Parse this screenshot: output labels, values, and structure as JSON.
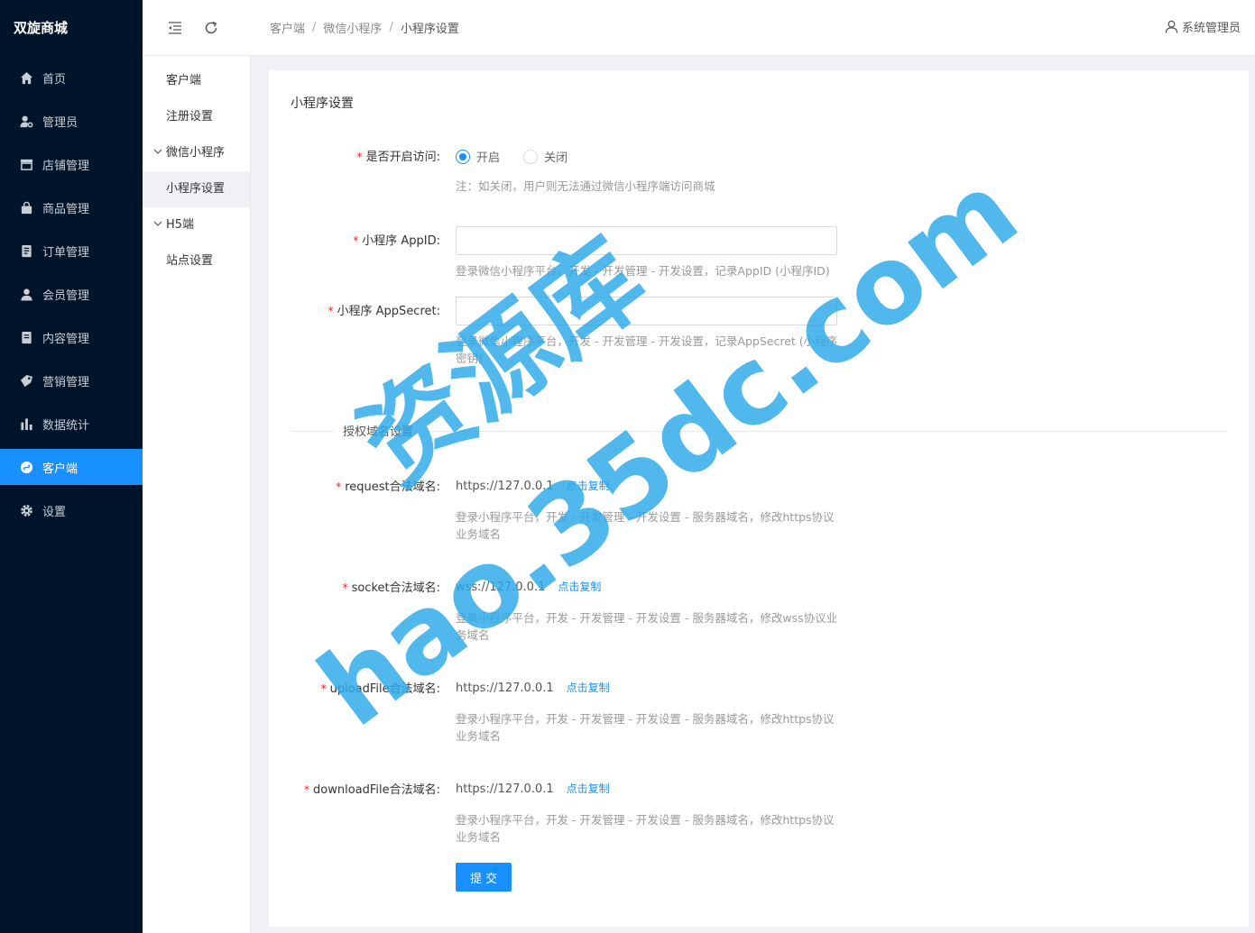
{
  "brand": "双旋商城",
  "nav": [
    {
      "label": "首页",
      "icon": "home-icon"
    },
    {
      "label": "管理员",
      "icon": "admin-user-icon"
    },
    {
      "label": "店铺管理",
      "icon": "shop-icon"
    },
    {
      "label": "商品管理",
      "icon": "bag-icon"
    },
    {
      "label": "订单管理",
      "icon": "order-icon"
    },
    {
      "label": "会员管理",
      "icon": "member-icon"
    },
    {
      "label": "内容管理",
      "icon": "content-icon"
    },
    {
      "label": "营销管理",
      "icon": "marketing-icon"
    },
    {
      "label": "数据统计",
      "icon": "chart-icon"
    },
    {
      "label": "客户端",
      "icon": "client-icon",
      "active": true
    },
    {
      "label": "设置",
      "icon": "gear-icon"
    }
  ],
  "submenu": {
    "item_client": "客户端",
    "item_register": "注册设置",
    "group_wechat": "微信小程序",
    "item_mini_settings": "小程序设置",
    "group_h5": "H5端",
    "item_site": "站点设置"
  },
  "header": {
    "breadcrumb": [
      "客户端",
      "微信小程序",
      "小程序设置"
    ],
    "separator": "/",
    "user": "系统管理员"
  },
  "form": {
    "title": "小程序设置",
    "access_label": "是否开启访问:",
    "radio_on": "开启",
    "radio_off": "关闭",
    "access_selected": "开启",
    "access_hint": "注：如关闭，用户则无法通过微信小程序端访问商城",
    "appid_label": "小程序 AppID:",
    "appid_value": "",
    "appid_hint": "登录微信小程序平台，开发 - 开发管理 - 开发设置，记录AppID (小程序ID)",
    "secret_label": "小程序 AppSecret:",
    "secret_value": "",
    "secret_hint": "登录微信小程序平台，开发 - 开发管理 - 开发设置，记录AppSecret (小程序密钥)",
    "domain_section": "授权域名设置",
    "request_label": "request合法域名:",
    "request_value": "https://127.0.0.1",
    "request_hint": "登录小程序平台，开发 - 开发管理 - 开发设置 - 服务器域名，修改https协议业务域名",
    "socket_label": "socket合法域名:",
    "socket_value": "wss://127.0.0.1",
    "socket_hint": "登录小程序平台，开发 - 开发管理 - 开发设置 - 服务器域名，修改wss协议业务域名",
    "upload_label": "uploadFile合法域名:",
    "upload_value": "https://127.0.0.1",
    "upload_hint": "登录小程序平台，开发 - 开发管理 - 开发设置 - 服务器域名，修改https协议业务域名",
    "download_label": "downloadFile合法域名:",
    "download_value": "https://127.0.0.1",
    "download_hint": "登录小程序平台，开发 - 开发管理 - 开发设置 - 服务器域名，修改https协议业务域名",
    "copy_label": "点击复制",
    "submit_label": "提交"
  },
  "watermark": {
    "line1": "资源库",
    "line2": "hao.35dc.com"
  },
  "colors": {
    "sidebar_bg": "#001529",
    "accent": "#1890ff",
    "required": "#f5222d",
    "watermark": "#29a8e8"
  }
}
